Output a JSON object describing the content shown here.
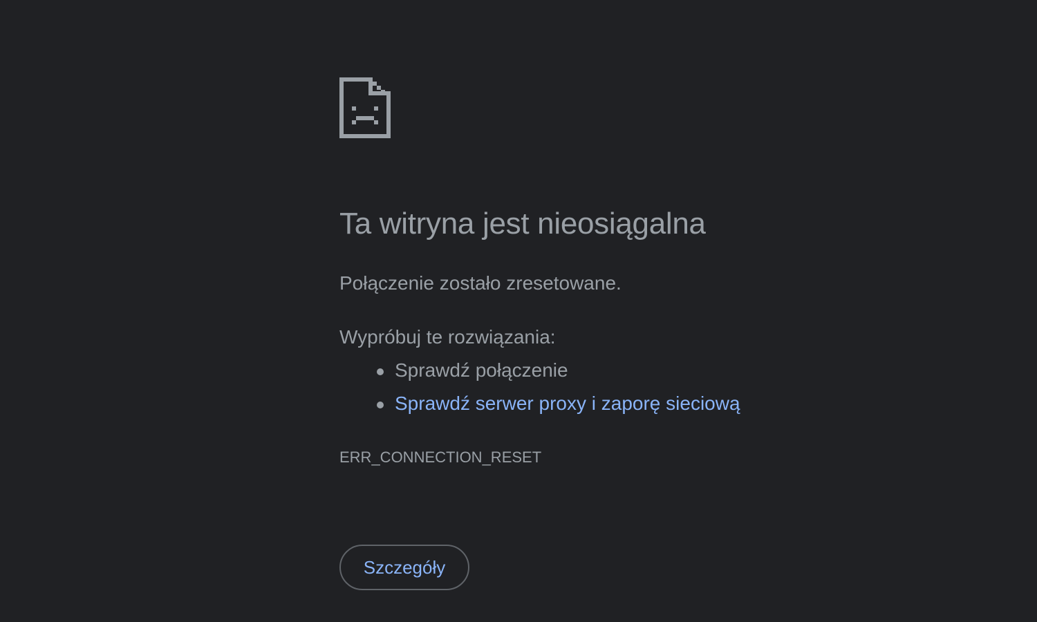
{
  "icon": "sad-document-icon",
  "title": "Ta witryna jest nieosiągalna",
  "subtitle": "Połączenie zostało zresetowane.",
  "suggestions_label": "Wypróbuj te rozwiązania:",
  "suggestions": [
    {
      "text": "Sprawdź połączenie",
      "is_link": false
    },
    {
      "text": "Sprawdź serwer proxy i zaporę sieciową",
      "is_link": true
    }
  ],
  "error_code": "ERR_CONNECTION_RESET",
  "details_button_label": "Szczegóły",
  "colors": {
    "background": "#202124",
    "text": "#9aa0a6",
    "link": "#8ab4f8",
    "button_border": "#5f6368"
  }
}
